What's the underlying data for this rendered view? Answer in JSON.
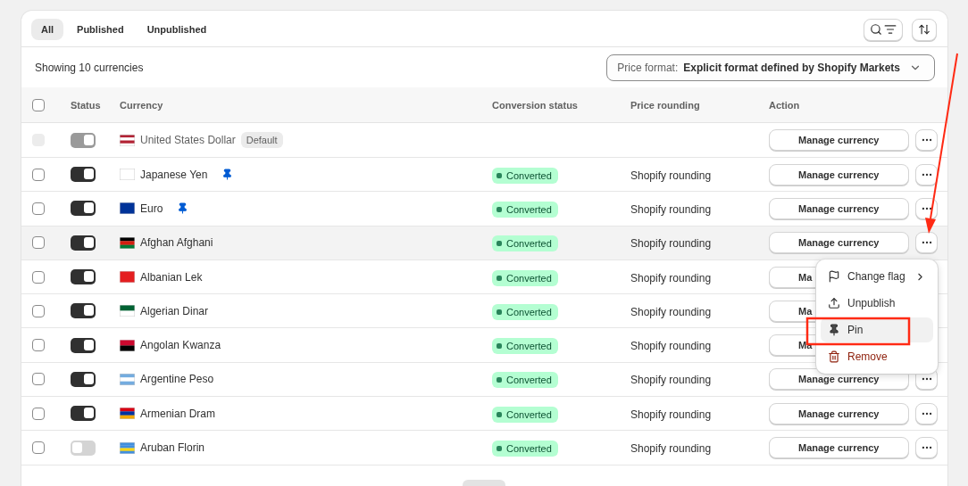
{
  "tabs": [
    {
      "label": "All",
      "selected": true
    },
    {
      "label": "Published",
      "selected": false
    },
    {
      "label": "Unpublished",
      "selected": false
    }
  ],
  "summary": "Showing 10 currencies",
  "price_format": {
    "label": "Price format:",
    "value": "Explicit format defined by Shopify Markets"
  },
  "select_all": {
    "checked": false
  },
  "columns": [
    "Status",
    "Currency",
    "Conversion status",
    "Price rounding",
    "Action"
  ],
  "rows": [
    {
      "name": "United States Dollar",
      "badge": "Default",
      "on": true,
      "disabled": true,
      "checked": false,
      "pinned": false,
      "hovered": false,
      "action": "Manage currency"
    },
    {
      "name": "Japanese Yen",
      "on": true,
      "disabled": false,
      "checked": false,
      "pinned": true,
      "hovered": false,
      "conversion": "Converted",
      "rounding": "Shopify rounding",
      "action": "Manage currency"
    },
    {
      "name": "Euro",
      "on": true,
      "disabled": false,
      "checked": false,
      "pinned": true,
      "hovered": false,
      "conversion": "Converted",
      "rounding": "Shopify rounding",
      "action": "Manage currency"
    },
    {
      "name": "Afghan Afghani",
      "on": true,
      "disabled": false,
      "checked": false,
      "pinned": false,
      "hovered": true,
      "conversion": "Converted",
      "rounding": "Shopify rounding",
      "action": "Manage currency"
    },
    {
      "name": "Albanian Lek",
      "on": true,
      "disabled": false,
      "checked": false,
      "pinned": false,
      "hovered": false,
      "conversion": "Converted",
      "rounding": "Shopify rounding",
      "action": "Ma"
    },
    {
      "name": "Algerian Dinar",
      "on": true,
      "disabled": false,
      "checked": false,
      "pinned": false,
      "hovered": false,
      "conversion": "Converted",
      "rounding": "Shopify rounding",
      "action": "Ma"
    },
    {
      "name": "Angolan Kwanza",
      "on": true,
      "disabled": false,
      "checked": false,
      "pinned": false,
      "hovered": false,
      "conversion": "Converted",
      "rounding": "Shopify rounding",
      "action": "Ma"
    },
    {
      "name": "Argentine Peso",
      "on": true,
      "disabled": false,
      "checked": false,
      "pinned": false,
      "hovered": false,
      "conversion": "Converted",
      "rounding": "Shopify rounding",
      "action": "Manage currency"
    },
    {
      "name": "Armenian Dram",
      "on": true,
      "disabled": false,
      "checked": false,
      "pinned": false,
      "hovered": false,
      "conversion": "Converted",
      "rounding": "Shopify rounding",
      "action": "Manage currency"
    },
    {
      "name": "Aruban Florin",
      "on": false,
      "disabled": false,
      "checked": false,
      "pinned": false,
      "hovered": false,
      "conversion": "Converted",
      "rounding": "Shopify rounding",
      "action": "Manage currency"
    }
  ],
  "menu": {
    "items": [
      {
        "label": "Change flag",
        "kind": "submenu",
        "selected": false
      },
      {
        "label": "Unpublish",
        "kind": "upload",
        "selected": false
      },
      {
        "label": "Pin",
        "kind": "pin",
        "selected": true
      },
      {
        "label": "Remove",
        "kind": "destructive",
        "selected": false
      }
    ]
  }
}
